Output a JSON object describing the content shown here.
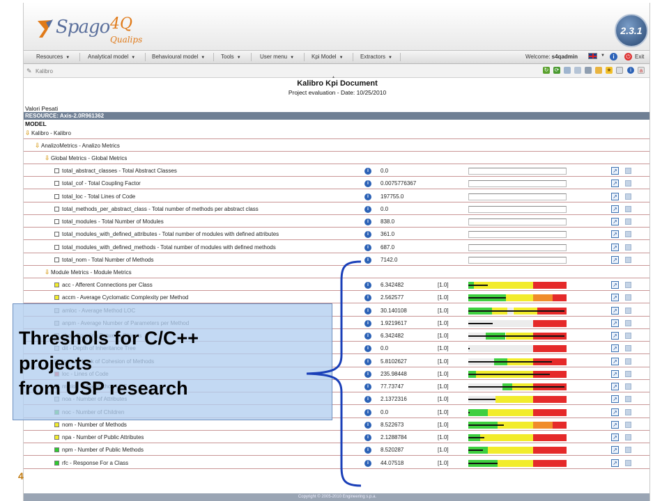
{
  "app": {
    "logo_text": "Spago",
    "logo_suffix": "4Q",
    "logo_sub": "Qualips",
    "version": "2.3.1"
  },
  "menu": [
    {
      "label": "Resources"
    },
    {
      "label": "Analytical model"
    },
    {
      "label": "Behavioural model"
    },
    {
      "label": "Tools"
    },
    {
      "label": "User menu"
    },
    {
      "label": "Kpi Model"
    },
    {
      "label": "Extractors"
    }
  ],
  "user": {
    "welcome": "Welcome:",
    "name": "s4qadmin",
    "exit": "Exit"
  },
  "toolbar": {
    "breadcrumb": "Kalibro"
  },
  "document": {
    "title": "Kalibro Kpi Document",
    "subtitle": "Project evaluation - Date: 10/25/2010",
    "valori": "Valori Pesati",
    "resource": "RESOURCE: Axis-2.0R961362",
    "model_header": "MODEL"
  },
  "tree": [
    {
      "label": "Kalibro - Kalibro"
    },
    {
      "label": "AnalizoMetrics - Analizo Metrics"
    },
    {
      "label": "Global Metrics - Global Metrics"
    }
  ],
  "global_metrics": [
    {
      "label": "total_abstract_classes - Total Abstract Classes",
      "value": "0.0"
    },
    {
      "label": "total_cof - Total Coupling Factor",
      "value": "0.0075776367"
    },
    {
      "label": "total_loc - Total Lines of Code",
      "value": "197755.0"
    },
    {
      "label": "total_methods_per_abstract_class - Total number of methods per abstract class",
      "value": "0.0"
    },
    {
      "label": "total_modules - Total Number of Modules",
      "value": "838.0"
    },
    {
      "label": "total_modules_with_defined_attributes - Total number of modules with defined attributes",
      "value": "361.0"
    },
    {
      "label": "total_modules_with_defined_methods - Total number of modules with defined methods",
      "value": "687.0"
    },
    {
      "label": "total_nom - Total Number of Methods",
      "value": "7142.0"
    }
  ],
  "module_group": {
    "label": "Module Metrics - Module Metrics"
  },
  "module_metrics": [
    {
      "label": "acc - Afferent Connections per Class",
      "value": "6.342482",
      "weight": "[1.0]",
      "status": "yellow",
      "indicator": 0.2
    },
    {
      "label": "accm - Average Cyclomatic Complexity per Method",
      "value": "2.562577",
      "weight": "[1.0]",
      "status": "yellow",
      "indicator": 0.38
    },
    {
      "label": "amloc - Average Method LOC",
      "value": "30.140108",
      "weight": "[1.0]",
      "status": "",
      "indicator": 0.98
    },
    {
      "label": "anpm - Average Number of Parameters per Method",
      "value": "1.9219617",
      "weight": "[1.0]",
      "status": "",
      "indicator": 0.25
    },
    {
      "label": "cbo - Coupling Between Objects",
      "value": "6.342482",
      "weight": "[1.0]",
      "status": "",
      "indicator": 0.98
    },
    {
      "label": "dit - Depth of Inheritance Tree",
      "value": "0.0",
      "weight": "[1.0]",
      "status": "",
      "indicator": 0.0
    },
    {
      "label": "lcom4 - Lack of Cohesion of Methods",
      "value": "5.8102627",
      "weight": "[1.0]",
      "status": "",
      "indicator": 0.85
    },
    {
      "label": "loc - Lines of Code",
      "value": "235.98448",
      "weight": "[1.0]",
      "status": "red",
      "indicator": 0.83
    },
    {
      "label": "mmloc - Max Method LOC",
      "value": "77.73747",
      "weight": "[1.0]",
      "status": "",
      "indicator": 0.98
    },
    {
      "label": "noa - Number of Attributes",
      "value": "2.1372316",
      "weight": "[1.0]",
      "status": "",
      "indicator": 0.28
    },
    {
      "label": "noc - Number of Children",
      "value": "0.0",
      "weight": "[1.0]",
      "status": "green",
      "indicator": 0.0
    },
    {
      "label": "nom - Number of Methods",
      "value": "8.522673",
      "weight": "[1.0]",
      "status": "yellow",
      "indicator": 0.36
    },
    {
      "label": "npa - Number of Public Attributes",
      "value": "2.1288784",
      "weight": "[1.0]",
      "status": "yellow",
      "indicator": 0.16
    },
    {
      "label": "npm - Number of Public Methods",
      "value": "8.520287",
      "weight": "[1.0]",
      "status": "green",
      "indicator": 0.15
    },
    {
      "label": "rfc - Response For a Class",
      "value": "44.07518",
      "weight": "[1.0]",
      "status": "green",
      "indicator": 0.3
    }
  ],
  "overlay": {
    "line1": "Threshols for C/C++",
    "line2": "projects",
    "line3": "from USP research"
  },
  "footer": "Copyright © 2005-2010 Engineering s.p.a.",
  "page_fragment": "4",
  "colors": {
    "green": "#3fcf3f",
    "yellow": "#f2ec2c",
    "orange": "#f08c2a",
    "red": "#e52a2a",
    "grey": "#ececec",
    "brace": "#1a3fb8"
  }
}
